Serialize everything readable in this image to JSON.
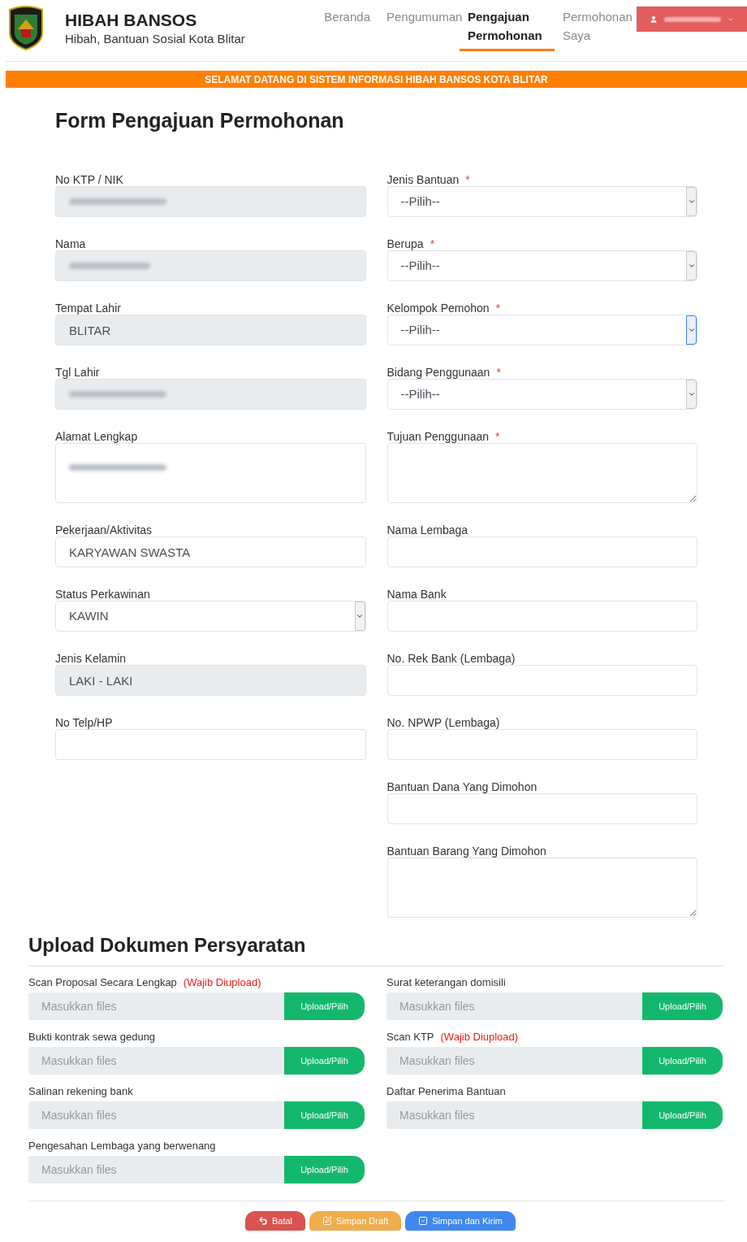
{
  "header": {
    "title": "HIBAH BANSOS",
    "subtitle": "Hibah, Bantuan Sosial Kota Blitar",
    "nav": [
      {
        "label": "Beranda",
        "selected": false
      },
      {
        "label": "Pengumuman",
        "selected": false
      },
      {
        "label": "Pengajuan Permohonan",
        "selected": true
      },
      {
        "label": "Permohonan Saya",
        "selected": false
      }
    ],
    "user_button": {
      "kind": "redacted"
    }
  },
  "banner": "SELAMAT DATANG DI SISTEM INFORMASI HIBAH BANSOS KOTA BLITAR",
  "form": {
    "title": "Form Pengajuan Permohonan",
    "left_fields": [
      {
        "label": "No KTP / NIK",
        "kind": "redacted",
        "disabled": true
      },
      {
        "label": "Nama",
        "kind": "redacted",
        "disabled": true
      },
      {
        "label": "Tempat Lahir",
        "kind": "input",
        "value": "BLITAR",
        "disabled": true
      },
      {
        "label": "Tgl Lahir",
        "kind": "redacted",
        "disabled": true
      },
      {
        "label": "Alamat Lengkap",
        "kind": "redacted_textarea",
        "disabled": false
      },
      {
        "label": "Pekerjaan/Aktivitas",
        "kind": "input",
        "value": "KARYAWAN SWASTA",
        "disabled": false
      },
      {
        "label": "Status Perkawinan",
        "kind": "select",
        "value": "KAWIN",
        "disabled": false,
        "focused": false
      },
      {
        "label": "Jenis Kelamin",
        "kind": "input",
        "value": "LAKI - LAKI",
        "disabled": true
      },
      {
        "label": "No Telp/HP",
        "kind": "input",
        "disabled": false
      }
    ],
    "right_fields": [
      {
        "label": "Jenis Bantuan",
        "required_mark": "*",
        "kind": "select",
        "value": "--Pilih--",
        "disabled": false,
        "focused": false
      },
      {
        "label": "Berupa",
        "required_mark": "*",
        "kind": "select",
        "value": "--Pilih--",
        "disabled": false,
        "focused": false
      },
      {
        "label": "Kelompok Pemohon",
        "required_mark": "*",
        "kind": "select",
        "value": "--Pilih--",
        "disabled": false,
        "focused": true
      },
      {
        "label": "Bidang Penggunaan",
        "required_mark": "*",
        "kind": "select",
        "value": "--Pilih--",
        "disabled": false,
        "focused": false
      },
      {
        "label": "Tujuan Penggunaan",
        "required_mark": "*",
        "kind": "textarea",
        "disabled": false
      },
      {
        "label": "Nama Lembaga",
        "kind": "input",
        "disabled": false
      },
      {
        "label": "Nama Bank",
        "kind": "input",
        "disabled": false
      },
      {
        "label": "No. Rek Bank (Lembaga)",
        "kind": "input",
        "disabled": false
      },
      {
        "label": "No. NPWP (Lembaga)",
        "kind": "input",
        "disabled": false
      },
      {
        "label": "Bantuan Dana Yang Dimohon",
        "kind": "input",
        "disabled": false
      },
      {
        "label": "Bantuan Barang Yang Dimohon",
        "kind": "textarea",
        "disabled": false
      }
    ]
  },
  "upload": {
    "title": "Upload Dokumen Persyaratan",
    "items": [
      {
        "label": "Scan Proposal Secara Lengkap",
        "note": "(Wajib Diupload)",
        "placeholder": "Masukkan files",
        "button": "Upload/Pilih"
      },
      {
        "label": "Surat keterangan domisili",
        "placeholder": "Masukkan files",
        "button": "Upload/Pilih"
      },
      {
        "label": "Bukti kontrak sewa gedung",
        "placeholder": "Masukkan files",
        "button": "Upload/Pilih"
      },
      {
        "label": "Scan KTP",
        "note": "(Wajib Diupload)",
        "placeholder": "Masukkan files",
        "button": "Upload/Pilih"
      },
      {
        "label": "Salinan rekening bank",
        "placeholder": "Masukkan files",
        "button": "Upload/Pilih"
      },
      {
        "label": "Daftar Penerima Bantuan",
        "placeholder": "Masukkan files",
        "button": "Upload/Pilih"
      },
      {
        "label": "Pengesahan Lembaga yang berwenang",
        "placeholder": "Masukkan files",
        "button": "Upload/Pilih"
      }
    ]
  },
  "actions": [
    {
      "label": "Batal",
      "kind": "cancel"
    },
    {
      "label": "Simpan Draft",
      "kind": "draft"
    },
    {
      "label": "Simpan dan Kirim",
      "kind": "submit"
    }
  ]
}
